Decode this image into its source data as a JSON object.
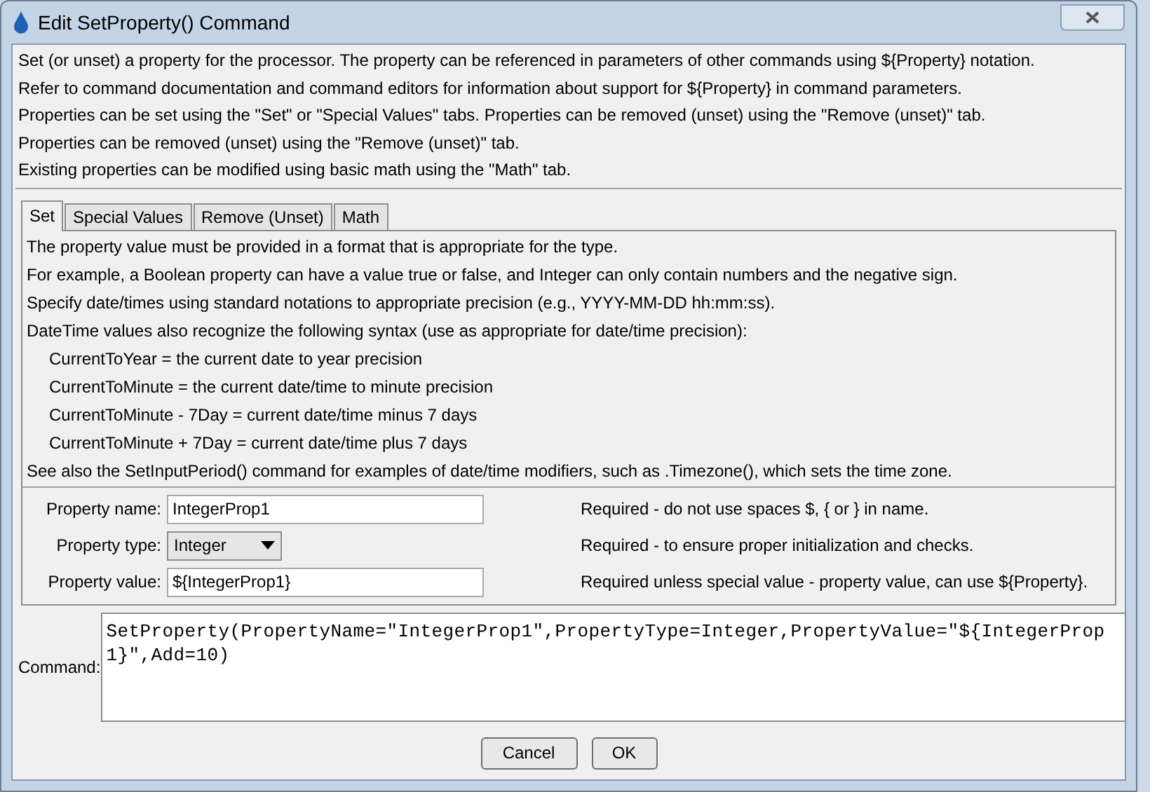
{
  "window": {
    "title": "Edit SetProperty() Command"
  },
  "description": [
    "Set (or unset) a property for the processor.  The property can be referenced in parameters of other commands using ${Property} notation.",
    "Refer to command documentation and command editors for information about support for ${Property} in command parameters.",
    "Properties can be set using the \"Set\" or \"Special Values\" tabs.  Properties can be removed (unset) using the \"Remove (unset)\" tab.",
    "Properties can be removed (unset) using the \"Remove (unset)\" tab.",
    "Existing properties can be modified using basic math using the \"Math\" tab."
  ],
  "tabs": [
    {
      "label": "Set",
      "selected": true
    },
    {
      "label": "Special Values",
      "selected": false
    },
    {
      "label": "Remove (Unset)",
      "selected": false
    },
    {
      "label": "Math",
      "selected": false
    }
  ],
  "tab_notes": [
    {
      "text": "The property value must be provided in a format that is appropriate for the type.",
      "indented": false
    },
    {
      "text": "For example, a Boolean property can have a value true or false, and Integer can only contain numbers and the negative sign.",
      "indented": false
    },
    {
      "text": "Specify date/times using standard notations to appropriate precision (e.g., YYYY-MM-DD hh:mm:ss).",
      "indented": false
    },
    {
      "text": "DateTime values also recognize the following syntax (use as appropriate for date/time precision):",
      "indented": false
    },
    {
      "text": "CurrentToYear = the current date to year precision",
      "indented": true
    },
    {
      "text": "CurrentToMinute = the current date/time to minute precision",
      "indented": true
    },
    {
      "text": "CurrentToMinute - 7Day = current date/time minus 7 days",
      "indented": true
    },
    {
      "text": "CurrentToMinute + 7Day = current date/time plus 7 days",
      "indented": true
    },
    {
      "text": "See also the SetInputPeriod() command for examples of date/time modifiers, such as .Timezone(), which sets the time zone.",
      "indented": false
    }
  ],
  "fields": [
    {
      "kind": "text",
      "label": "Property name:",
      "value": "IntegerProp1",
      "hint": "Required - do not use spaces $, { or } in name."
    },
    {
      "kind": "dropdown",
      "label": "Property type:",
      "value": "Integer",
      "hint": "Required - to ensure proper initialization and checks."
    },
    {
      "kind": "text",
      "label": "Property value:",
      "value": "${IntegerProp1}",
      "hint": "Required unless special value - property value, can use ${Property}."
    }
  ],
  "command": {
    "label": "Command:",
    "value": "SetProperty(PropertyName=\"IntegerProp1\",PropertyType=Integer,PropertyValue=\"${IntegerProp1}\",Add=10)"
  },
  "buttons": [
    "Cancel",
    "OK"
  ]
}
